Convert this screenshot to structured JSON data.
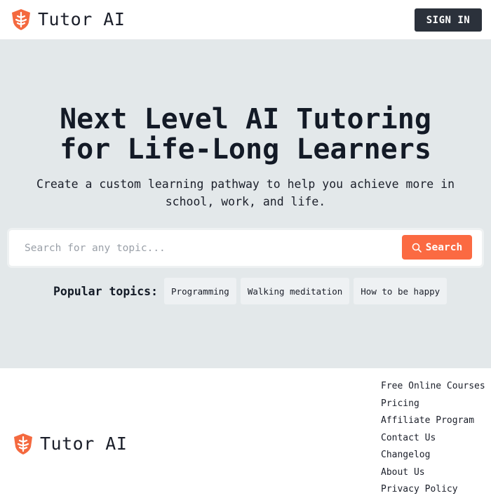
{
  "header": {
    "brand_name": "Tutor AI",
    "signin_label": "SIGN IN"
  },
  "hero": {
    "title_line1": "Next Level AI Tutoring",
    "title_line2": "for Life-Long Learners",
    "subtitle": "Create a custom learning pathway to help you achieve more in school, work, and life."
  },
  "search": {
    "placeholder": "Search for any topic...",
    "value": "",
    "button_label": "Search",
    "button_icon": "search-icon"
  },
  "popular": {
    "label": "Popular topics:",
    "topics": [
      "Programming",
      "Walking meditation",
      "How to be happy"
    ]
  },
  "footer": {
    "brand_name": "Tutor AI",
    "links": [
      "Free Online Courses",
      "Pricing",
      "Affiliate Program",
      "Contact Us",
      "Changelog",
      "About Us",
      "Privacy Policy"
    ]
  },
  "colors": {
    "accent": "#fb6a42",
    "logo": "#f4693f",
    "dark_button": "#2b313b",
    "hero_background": "#e3e8ea"
  },
  "icons": {
    "logo": "shield-tree-logo-icon",
    "search": "search-icon"
  }
}
